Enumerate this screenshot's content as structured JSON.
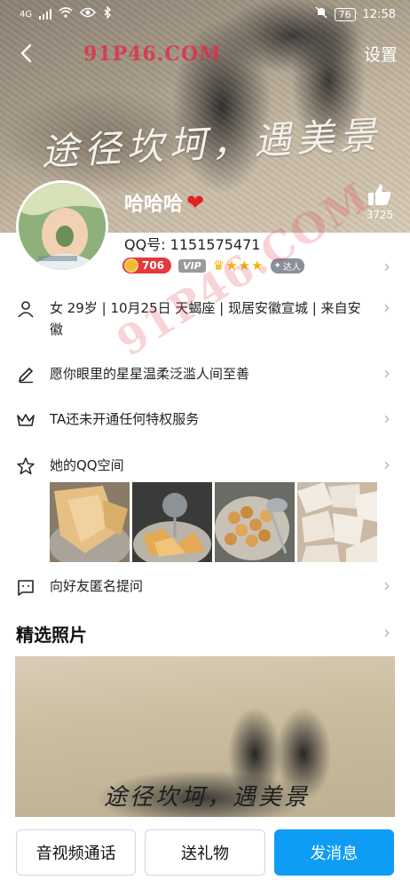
{
  "status": {
    "carrier": "4G",
    "battery": "76",
    "time": "12:58"
  },
  "nav": {
    "settings_label": "设置",
    "watermark": "91P46.COM"
  },
  "cover": {
    "text": "途径坎坷，遇美景",
    "likes": "3725"
  },
  "profile": {
    "nickname": "哈哈哈",
    "qq_label": "QQ号: 1151575471",
    "level": "706",
    "vip": "VIP",
    "talent": "达人"
  },
  "info": {
    "basic": "女  29岁  |  10月25日  天蝎座  |  现居安徽宣城  |  来自安徽",
    "signature": "愿你眼里的星星温柔泛滥人间至善",
    "privilege": "TA还未开通任何特权服务",
    "qzone": "她的QQ空间",
    "ask": "向好友匿名提问"
  },
  "featured": {
    "title": "精选照片",
    "text": "途径坎坷，遇美景"
  },
  "actions": {
    "call": "音视频通话",
    "gift": "送礼物",
    "message": "发消息"
  },
  "watermark2": "91P46.COM"
}
